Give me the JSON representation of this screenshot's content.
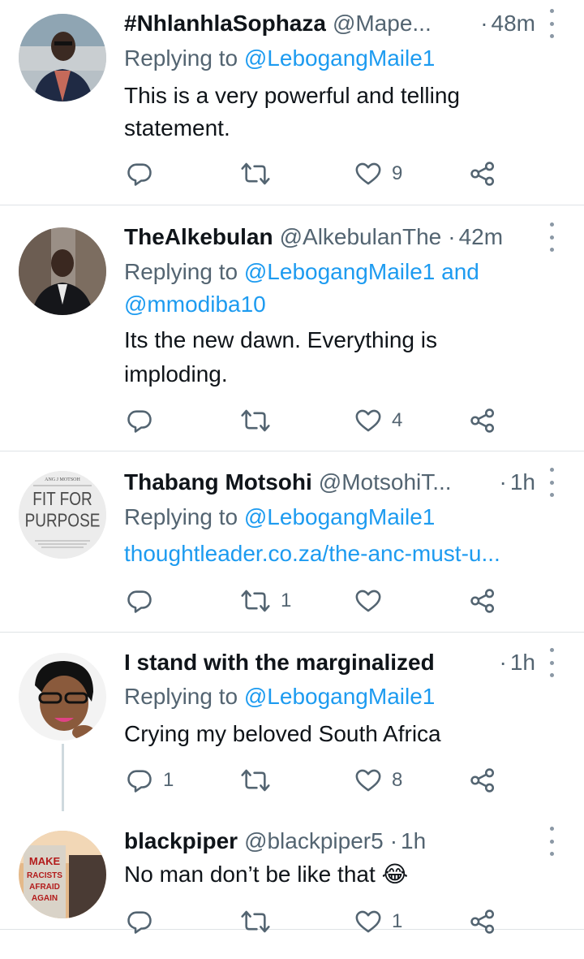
{
  "tweets": [
    {
      "name": "#NhlanhlaSophaza",
      "handle": "@Mape...",
      "separator": "·",
      "time": "48m",
      "reply_prefix": "Replying to",
      "reply_users": "@LebogangMaile1",
      "body_lines": [
        "This is a very powerful and telling",
        "statement."
      ],
      "counts": {
        "reply": "",
        "retweet": "",
        "like": "9"
      }
    },
    {
      "name": "TheAlkebulan",
      "handle": "@AlkebulanThe",
      "separator": "·",
      "time": "42m",
      "reply_prefix": "Replying to",
      "reply_users": "@LebogangMaile1",
      "reply_and": "and",
      "reply_users_2": "@mmodiba10",
      "body_lines": [
        "Its the new dawn. Everything is",
        "imploding."
      ],
      "counts": {
        "reply": "",
        "retweet": "",
        "like": "4"
      }
    },
    {
      "name": "Thabang Motsohi",
      "handle": "@MotsohiT...",
      "separator": "·",
      "time": "1h",
      "reply_prefix": "Replying to",
      "reply_users": "@LebogangMaile1",
      "link": "thoughtleader.co.za/the-anc-must-u...",
      "avatar_text": {
        "top": "ANG J MOTSOH",
        "line1": "FIT FOR",
        "line2": "PURPOSE"
      },
      "counts": {
        "reply": "",
        "retweet": "1",
        "like": ""
      }
    },
    {
      "name": "I stand with the marginalized",
      "separator": "·",
      "time": "1h",
      "reply_prefix": "Replying to",
      "reply_users": "@LebogangMaile1",
      "body_lines": [
        "Crying my beloved South Africa"
      ],
      "counts": {
        "reply": "1",
        "retweet": "",
        "like": "8"
      }
    },
    {
      "name": "blackpiper",
      "handle": "@blackpiper5",
      "separator": "·",
      "time": "1h",
      "body_lines": [
        "No man don’t be like that 😂"
      ],
      "avatar_text": {
        "line1": "MAKE",
        "line2": "RACISTS",
        "line3": "AFRAID",
        "line4": "AGAIN"
      },
      "counts": {
        "reply": "",
        "retweet": "",
        "like": "1"
      }
    }
  ],
  "icons": {
    "reply": "reply-icon",
    "retweet": "retweet-icon",
    "like": "heart-icon",
    "share": "share-icon",
    "more": "more-options-icon"
  },
  "colors": {
    "text": "#0f1419",
    "secondary": "#536471",
    "link": "#1d9bf0",
    "divider": "#dfe3e6"
  }
}
